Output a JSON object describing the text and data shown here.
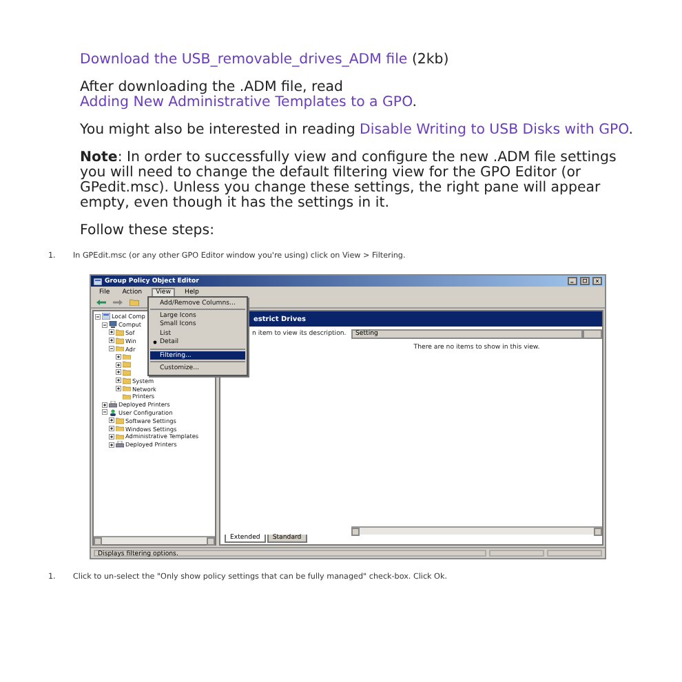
{
  "intro": [
    {
      "parts": [
        {
          "kind": "link",
          "text": "Download the USB_removable_drives_ADM file"
        },
        {
          "kind": "text",
          "text": " (2kb)"
        }
      ]
    },
    {
      "parts": [
        {
          "kind": "text",
          "text": "After downloading the .ADM file, read "
        },
        {
          "kind": "link",
          "text": "Adding New Administrative Templates to a GPO"
        },
        {
          "kind": "text",
          "text": "."
        }
      ]
    },
    {
      "parts": [
        {
          "kind": "text",
          "text": "You might also be interested in reading "
        },
        {
          "kind": "link",
          "text": "Disable Writing to USB Disks with GPO"
        },
        {
          "kind": "text",
          "text": "."
        }
      ]
    },
    {
      "parts": [
        {
          "kind": "text",
          "text": "**Note**: In order to successfully view and configure the new .ADM file settings you will need to change the default filtering view for the GPO Editor (or GPedit.msc). Unless you change these settings, the right pane will appear empty, even though it has the settings in it."
        }
      ]
    },
    {
      "parts": [
        {
          "kind": "text",
          "text": "Follow these steps:"
        }
      ]
    }
  ],
  "steps": [
    {
      "number": "1.",
      "text": "In GPEdit.msc (or any other GPO Editor window you're using) click on View > Filtering.",
      "screenshot": {
        "title": "Group Policy Object Editor",
        "menu": [
          {
            "label": "File",
            "selected": false
          },
          {
            "label": "Action",
            "selected": false
          },
          {
            "label": "View",
            "selected": true
          },
          {
            "label": "Help",
            "selected": false
          }
        ],
        "tree": [
          {
            "label": "Local Comp",
            "kind": "policy",
            "expanded": true,
            "children": [
              {
                "label": "Comput",
                "kind": "computer",
                "expanded": true,
                "children": [
                  {
                    "label": "Sof",
                    "kind": "folder",
                    "expanded": false
                  },
                  {
                    "label": "Win",
                    "kind": "folder",
                    "expanded": false
                  },
                  {
                    "label": "Adr",
                    "kind": "folder",
                    "expanded": true,
                    "children": [
                      {
                        "kind": "folder",
                        "expanded": false
                      },
                      {
                        "kind": "folder",
                        "expanded": false
                      },
                      {
                        "kind": "folder",
                        "expanded": false
                      },
                      {
                        "label": "System",
                        "kind": "folder",
                        "expanded": false
                      },
                      {
                        "label": "Network",
                        "kind": "folder",
                        "expanded": false
                      },
                      {
                        "label": "Printers",
                        "kind": "folder"
                      }
                    ]
                  }
                ]
              },
              {
                "label": "Deployed Printers",
                "kind": "printer",
                "expanded": false
              },
              {
                "label": "User Configuration",
                "kind": "user",
                "expanded": true,
                "children": [
                  {
                    "label": "Software Settings",
                    "kind": "folder",
                    "expanded": false
                  },
                  {
                    "label": "Windows Settings",
                    "kind": "folder",
                    "expanded": false
                  },
                  {
                    "label": "Administrative Templates",
                    "kind": "folder",
                    "expanded": false
                  },
                  {
                    "label": "Deployed Printers",
                    "kind": "printer",
                    "expanded": false
                  }
                ]
              }
            ]
          }
        ],
        "view_menu": [
          {
            "kind": "item",
            "label": "Add/Remove Columns...",
            "checked": false,
            "selected": false
          },
          {
            "kind": "separator"
          },
          {
            "kind": "item",
            "label": "Large Icons",
            "checked": false,
            "selected": false
          },
          {
            "kind": "item",
            "label": "Small Icons",
            "checked": false,
            "selected": false
          },
          {
            "kind": "item",
            "label": "List",
            "checked": false,
            "selected": false
          },
          {
            "kind": "item",
            "label": "Detail",
            "checked": true,
            "selected": false
          },
          {
            "kind": "separator"
          },
          {
            "kind": "item",
            "label": "Filtering...",
            "checked": false,
            "selected": true
          },
          {
            "kind": "separator"
          },
          {
            "kind": "item",
            "label": "Customize...",
            "checked": false,
            "selected": false
          }
        ],
        "pane_header": "estrict Drives",
        "description": "n item to view its description.",
        "columns": [
          "Setting"
        ],
        "empty_message": "There are no items to show in this view.",
        "tabs": [
          {
            "label": "Extended",
            "selected": true
          },
          {
            "label": "Standard",
            "selected": false
          }
        ],
        "status": "Displays filtering options."
      }
    },
    {
      "number": "1.",
      "text": "Click to un-select the \"Only show policy settings that can be fully managed\" check-box. Click Ok."
    }
  ]
}
